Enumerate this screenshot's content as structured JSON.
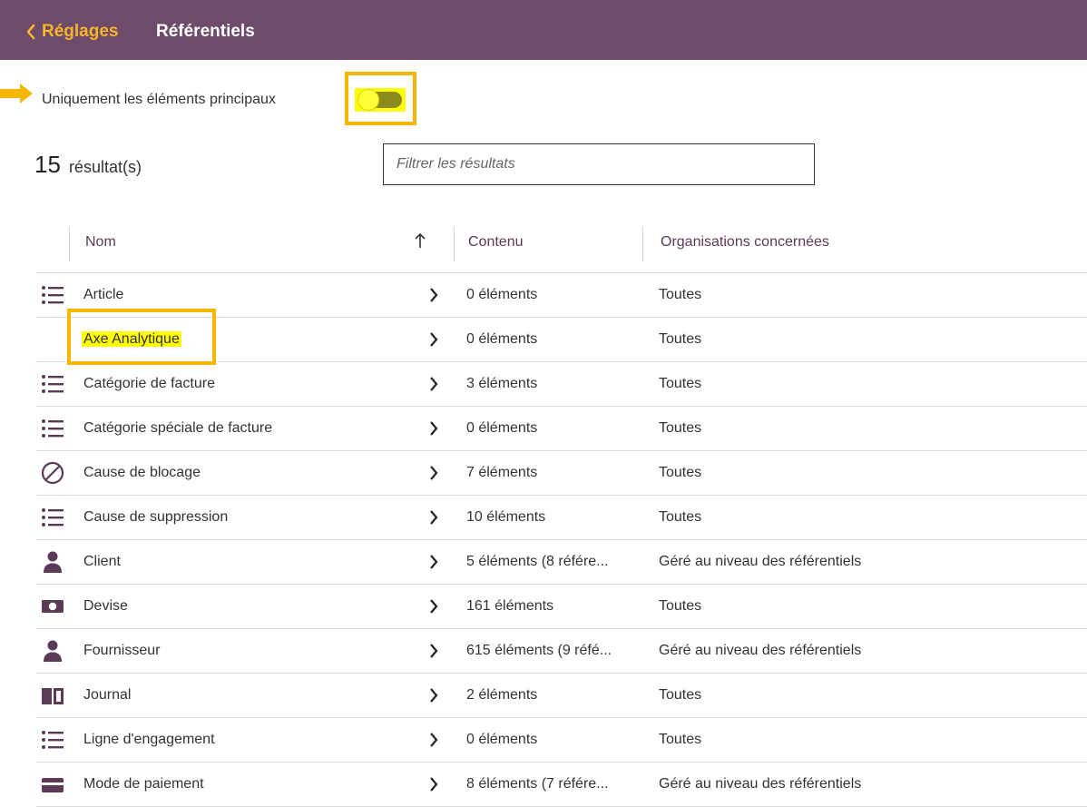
{
  "header": {
    "back_label": "Réglages",
    "title": "Référentiels"
  },
  "filters": {
    "toggle_label": "Uniquement les éléments principaux",
    "toggle_on": true,
    "result_count": "15",
    "result_label": "résultat(s)",
    "search_placeholder": "Filtrer les résultats"
  },
  "table": {
    "columns": {
      "name": "Nom",
      "content": "Contenu",
      "orgs": "Organisations concernées"
    },
    "rows": [
      {
        "name": "Article",
        "icon": "list-icon",
        "content": "0 éléments",
        "orgs": "Toutes"
      },
      {
        "name": "Axe Analytique",
        "icon": "",
        "content": "0 éléments",
        "orgs": "Toutes"
      },
      {
        "name": "Catégorie de facture",
        "icon": "list-icon",
        "content": "3 éléments",
        "orgs": "Toutes"
      },
      {
        "name": "Catégorie spéciale de facture",
        "icon": "list-icon",
        "content": "0 éléments",
        "orgs": "Toutes"
      },
      {
        "name": "Cause de blocage",
        "icon": "block-icon",
        "content": "7 éléments",
        "orgs": "Toutes"
      },
      {
        "name": "Cause de suppression",
        "icon": "list-icon",
        "content": "10 éléments",
        "orgs": "Toutes"
      },
      {
        "name": "Client",
        "icon": "person-icon",
        "content": "5 éléments (8 référe...",
        "orgs": "Géré au niveau des référentiels"
      },
      {
        "name": "Devise",
        "icon": "money-icon",
        "content": "161 éléments",
        "orgs": "Toutes"
      },
      {
        "name": "Fournisseur",
        "icon": "person-icon",
        "content": "615 éléments (9 réfé...",
        "orgs": "Géré au niveau des référentiels"
      },
      {
        "name": "Journal",
        "icon": "book-icon",
        "content": "2 éléments",
        "orgs": "Toutes"
      },
      {
        "name": "Ligne d'engagement",
        "icon": "list-icon",
        "content": "0 éléments",
        "orgs": "Toutes"
      },
      {
        "name": "Mode de paiement",
        "icon": "card-icon",
        "content": "8 éléments (7 référe...",
        "orgs": "Géré au niveau des référentiels"
      }
    ]
  },
  "colors": {
    "header_bg": "#6e4a6b",
    "accent_orange": "#f6b428",
    "highlight_yellow": "#ffff00",
    "icon_color": "#5b3a58"
  }
}
